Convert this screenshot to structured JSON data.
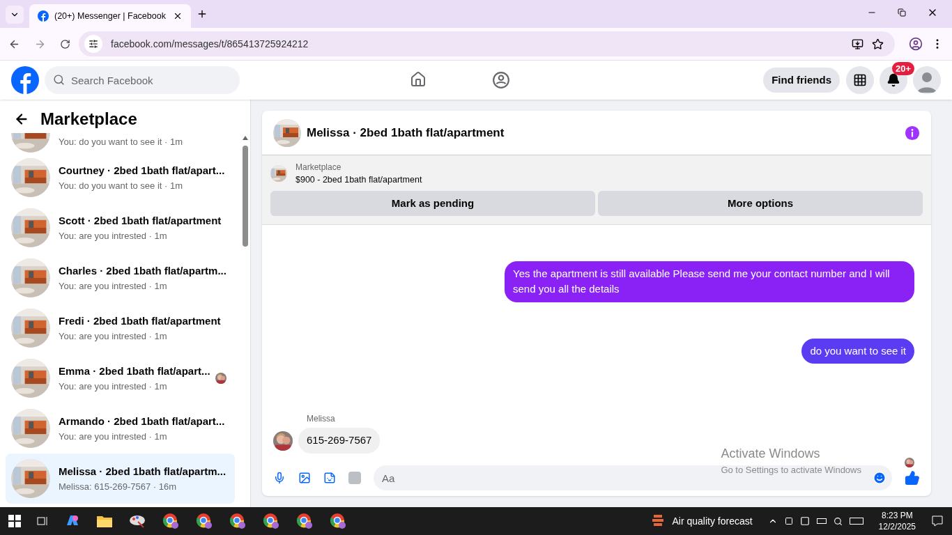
{
  "browser": {
    "tab_title": "(20+) Messenger | Facebook",
    "url": "facebook.com/messages/t/865413725924212"
  },
  "header": {
    "search_placeholder": "Search Facebook",
    "find_friends": "Find friends",
    "notification_badge": "20+"
  },
  "sidebar": {
    "title": "Marketplace",
    "items": [
      {
        "kind": "partial",
        "preview": "You: do you want to see it · 1m",
        "selected": false,
        "seen_avatar": false
      },
      {
        "kind": "full",
        "name": "Courtney · 2bed 1bath flat/apart...",
        "preview": "You: do you want to see it · 1m",
        "selected": false,
        "seen_avatar": false
      },
      {
        "kind": "full",
        "name": "Scott · 2bed 1bath flat/apartment",
        "preview": "You: are you intrested · 1m",
        "selected": false,
        "seen_avatar": false
      },
      {
        "kind": "full",
        "name": "Charles · 2bed 1bath flat/apartm...",
        "preview": "You: are you intrested · 1m",
        "selected": false,
        "seen_avatar": false
      },
      {
        "kind": "full",
        "name": "Fredi · 2bed 1bath flat/apartment",
        "preview": "You: are you intrested · 1m",
        "selected": false,
        "seen_avatar": false
      },
      {
        "kind": "full",
        "name": "Emma · 2bed 1bath flat/apart...",
        "preview": "You: are you intrested · 1m",
        "selected": false,
        "seen_avatar": true
      },
      {
        "kind": "full",
        "name": "Armando · 2bed 1bath flat/apart...",
        "preview": "You: are you intrested · 1m",
        "selected": false,
        "seen_avatar": false
      },
      {
        "kind": "full",
        "name": "Melissa · 2bed 1bath flat/apartm...",
        "preview": "Melissa: 615-269-7567 · 16m",
        "selected": true,
        "seen_avatar": false
      }
    ]
  },
  "chat": {
    "title": "Melissa · 2bed 1bath flat/apartment",
    "listing_label": "Marketplace",
    "listing_title": "$900 - 2bed 1bath flat/apartment",
    "buttons": [
      "Mark as pending",
      "More options"
    ],
    "messages": [
      {
        "kind": "outgoing",
        "text": "Yes the apartment is still available Please send me your contact number and I will send you all the details",
        "color": "#8a22f5"
      },
      {
        "kind": "outgoing",
        "text": "do you want to see it",
        "color": "#5b3cf2"
      },
      {
        "kind": "incoming",
        "sender": "Melissa",
        "text": "615-269-7567"
      }
    ],
    "composer_placeholder": "Aa"
  },
  "windows_notice": {
    "title": "Activate Windows",
    "subtitle": "Go to Settings to activate Windows"
  },
  "taskbar": {
    "weather": "Air quality forecast",
    "time": "8:23 PM",
    "date": "12/2/2025"
  }
}
